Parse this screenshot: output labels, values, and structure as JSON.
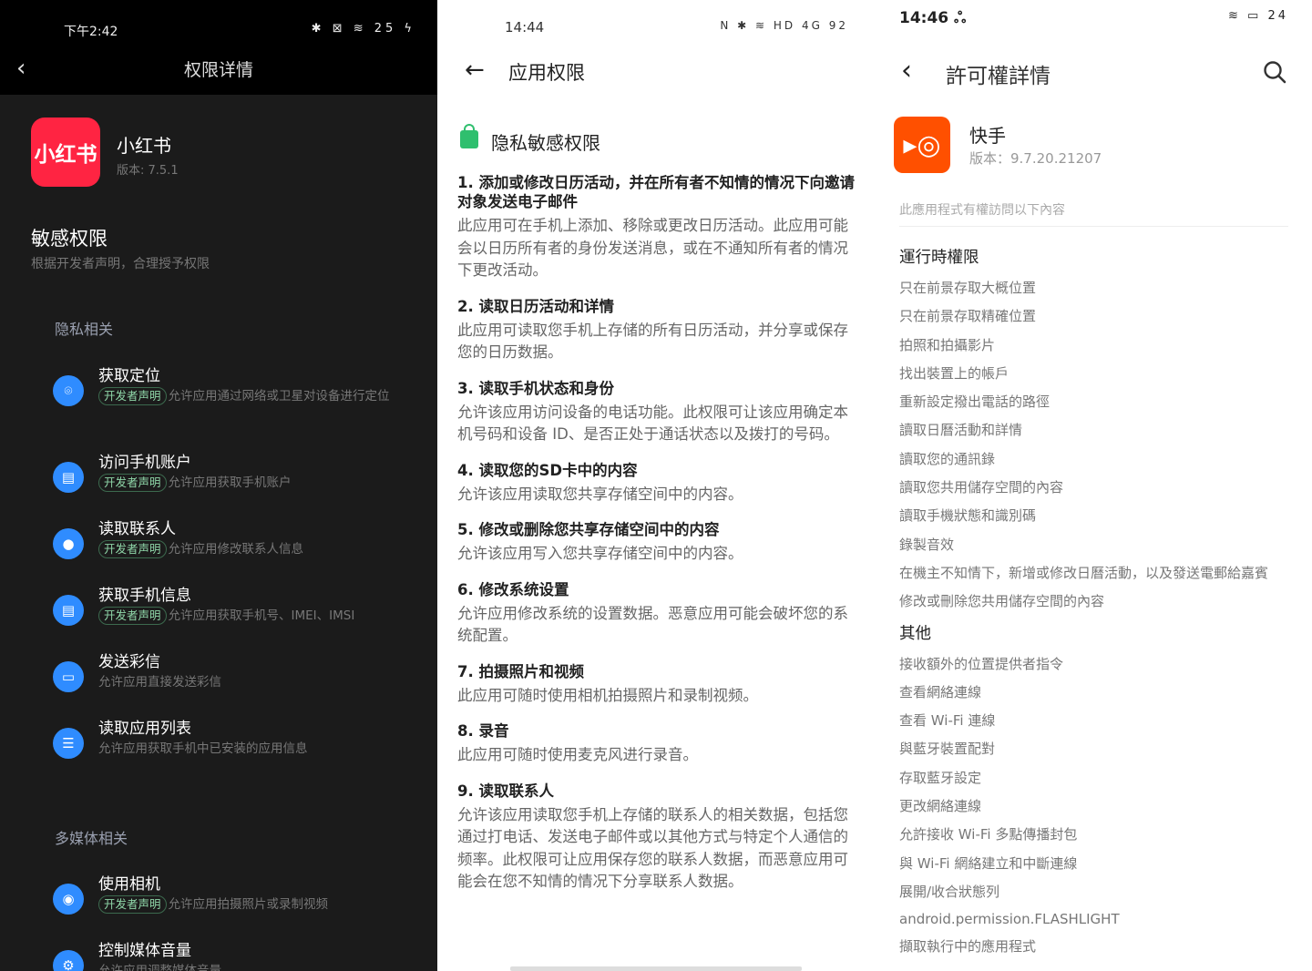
{
  "left": {
    "status": {
      "time": "下午2:42",
      "icons": "✱ ⊠ ≋ 25 ϟ"
    },
    "title": "权限详情",
    "app": {
      "icon_text": "小红书",
      "name": "小红书",
      "version": "版本: 7.5.1"
    },
    "section_title": "敏感权限",
    "section_subtitle": "根据开发者声明，合理授予权限",
    "badge": "开发者声明",
    "groups": [
      {
        "title": "隐私相关",
        "items": [
          {
            "icon": "location-icon",
            "glyph": "⌾",
            "title": "获取定位",
            "badge": true,
            "desc": "允许应用通过网络或卫星对设备进行定位"
          },
          {
            "icon": "account-icon",
            "glyph": "▤",
            "title": "访问手机账户",
            "badge": true,
            "desc": "允许应用获取手机账户"
          },
          {
            "icon": "contact-icon",
            "glyph": "●",
            "title": "读取联系人",
            "badge": true,
            "desc": "允许应用修改联系人信息"
          },
          {
            "icon": "phone-info-icon",
            "glyph": "▤",
            "title": "获取手机信息",
            "badge": true,
            "desc": "允许应用获取手机号、IMEI、IMSI"
          },
          {
            "icon": "message-icon",
            "glyph": "▭",
            "title": "发送彩信",
            "badge": false,
            "desc": "允许应用直接发送彩信"
          },
          {
            "icon": "app-list-icon",
            "glyph": "☰",
            "title": "读取应用列表",
            "badge": false,
            "desc": "允许应用获取手机中已安装的应用信息"
          }
        ]
      },
      {
        "title": "多媒体相关",
        "items": [
          {
            "icon": "camera-icon",
            "glyph": "◉",
            "title": "使用相机",
            "badge": true,
            "desc": "允许应用拍摄照片或录制视频"
          },
          {
            "icon": "gear-icon",
            "glyph": "⚙",
            "title": "控制媒体音量",
            "badge": false,
            "desc": "允许应用调整媒体音量"
          }
        ]
      }
    ]
  },
  "middle": {
    "status": {
      "time": "14:44",
      "icons": "N ✱ ≋ HD 4G 92"
    },
    "title": "应用权限",
    "section_title": "隐私敏感权限",
    "perms": [
      {
        "title": "1. 添加或修改日历活动，并在所有者不知情的情况下向邀请对象发送电子邮件",
        "desc": "此应用可在手机上添加、移除或更改日历活动。此应用可能会以日历所有者的身份发送消息，或在不通知所有者的情况下更改活动。"
      },
      {
        "title": "2. 读取日历活动和详情",
        "desc": "此应用可读取您手机上存储的所有日历活动，并分享或保存您的日历数据。"
      },
      {
        "title": "3. 读取手机状态和身份",
        "desc": "允许该应用访问设备的电话功能。此权限可让该应用确定本机号码和设备 ID、是否正处于通话状态以及拨打的号码。"
      },
      {
        "title": "4. 读取您的SD卡中的内容",
        "desc": "允许该应用读取您共享存储空间中的内容。"
      },
      {
        "title": "5. 修改或删除您共享存储空间中的内容",
        "desc": "允许该应用写入您共享存储空间中的内容。"
      },
      {
        "title": "6. 修改系统设置",
        "desc": "允许应用修改系统的设置数据。恶意应用可能会破坏您的系统配置。"
      },
      {
        "title": "7. 拍摄照片和视频",
        "desc": "此应用可随时使用相机拍摄照片和录制视频。"
      },
      {
        "title": "8. 录音",
        "desc": "此应用可随时使用麦克风进行录音。"
      },
      {
        "title": "9. 读取联系人",
        "desc": "允许该应用读取您手机上存储的联系人的相关数据，包括您通过打电话、发送电子邮件或以其他方式与特定个人通信的频率。此权限可让应用保存您的联系人数据，而恶意应用可能会在您不知情的情况下分享联系人数据。"
      }
    ]
  },
  "right": {
    "status": {
      "time": "14:46 ஃ",
      "icons": "≋ ▭ 24"
    },
    "title": "許可權詳情",
    "app": {
      "name": "快手",
      "version": "版本：9.7.20.21207"
    },
    "note": "此應用程式有權訪問以下內容",
    "runtime_title": "運行時權限",
    "runtime": [
      "只在前景存取大概位置",
      "只在前景存取精確位置",
      "拍照和拍攝影片",
      "找出裝置上的帳戶",
      "重新設定撥出電話的路徑",
      "讀取日曆活動和詳情",
      "讀取您的通訊錄",
      "讀取您共用儲存空間的內容",
      "讀取手機狀態和識別碼",
      "錄製音效",
      "在機主不知情下，新增或修改日曆活動，以及發送電郵給嘉賓",
      "修改或刪除您共用儲存空間的內容"
    ],
    "other_title": "其他",
    "other": [
      "接收額外的位置提供者指令",
      "查看網絡連線",
      "查看 Wi-Fi 連線",
      "與藍牙裝置配對",
      "存取藍牙設定",
      "更改網絡連線",
      "允許接收 Wi-Fi 多點傳播封包",
      "與 Wi-Fi 網絡建立和中斷連線",
      "展開/收合狀態列",
      "android.permission.FLASHLIGHT",
      "擷取執行中的應用程式"
    ]
  }
}
